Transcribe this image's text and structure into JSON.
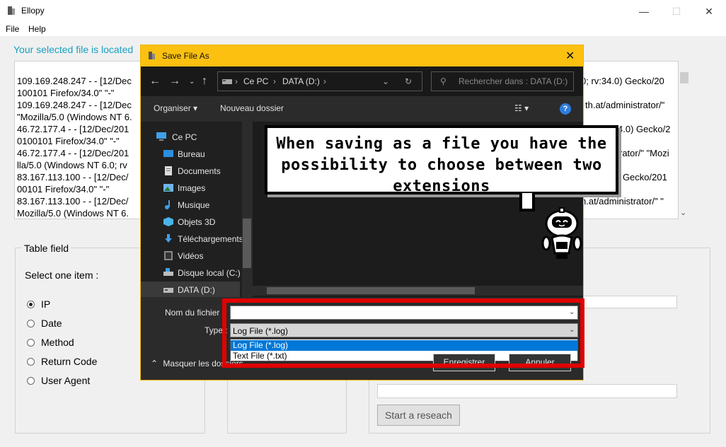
{
  "window": {
    "title": "Ellopy",
    "minimize": "—",
    "maximize": "☐",
    "close": "✕"
  },
  "menu": {
    "file": "File",
    "help": "Help"
  },
  "info_text": "Your selected file is located",
  "log": {
    "lines": [
      "109.169.248.247 - - [12/Dec",
      "100101 Firefox/34.0\" \"-\"",
      "109.169.248.247 - - [12/Dec",
      "\"Mozilla/5.0 (Windows NT 6.",
      "46.72.177.4 - - [12/Dec/201",
      "0100101 Firefox/34.0\" \"-\"",
      "46.72.177.4 - - [12/Dec/201",
      "lla/5.0 (Windows NT 6.0; rv",
      "83.167.113.100 - - [12/Dec/",
      "00101 Firefox/34.0\" \"-\"",
      "83.167.113.100 - - [12/Dec/",
      "Mozilla/5.0 (Windows NT 6."
    ],
    "right_fragments": [
      "0; rv:34.0) Gecko/20",
      "th.at/administrator/\"",
      "4.0) Gecko/2",
      "rator/\" \"Mozi",
      ") Gecko/201",
      "h.at/administrator/\" \""
    ]
  },
  "table_field": {
    "title": "Table field",
    "select_label": "Select one item :",
    "options": [
      "IP",
      "Date",
      "Method",
      "Return Code",
      "User Agent"
    ],
    "selected": "IP"
  },
  "search_button": "Start a reseach",
  "dialog": {
    "title": "Save File As",
    "close": "✕",
    "nav": {
      "back": "←",
      "forward": "→",
      "up": "↑"
    },
    "breadcrumb": [
      "Ce PC",
      "DATA (D:)"
    ],
    "search_placeholder": "Rechercher dans : DATA (D:)",
    "organize": "Organiser",
    "new_folder": "Nouveau dossier",
    "help": "?",
    "nav_items": [
      "Ce PC",
      "Bureau",
      "Documents",
      "Images",
      "Musique",
      "Objets 3D",
      "Téléchargements",
      "Vidéos",
      "Disque local (C:)",
      "DATA (D:)"
    ],
    "filename_label": "Nom du fichier :",
    "filename_value": "",
    "type_label": "Type :",
    "type_value": "Log File (*.log)",
    "type_options": [
      "Log File (*.log)",
      "Text File (*.txt)"
    ],
    "save_button": "Enregistrer",
    "cancel_button": "Annuler",
    "hide_folders": "Masquer les dossiers"
  },
  "annotation": {
    "text": "When saving as a file you have the possibility to choose between two extensions"
  },
  "colors": {
    "accent_info": "#18a0c0",
    "dialog_title": "#fcc010",
    "highlight": "#e00000",
    "selection": "#0078d7"
  }
}
